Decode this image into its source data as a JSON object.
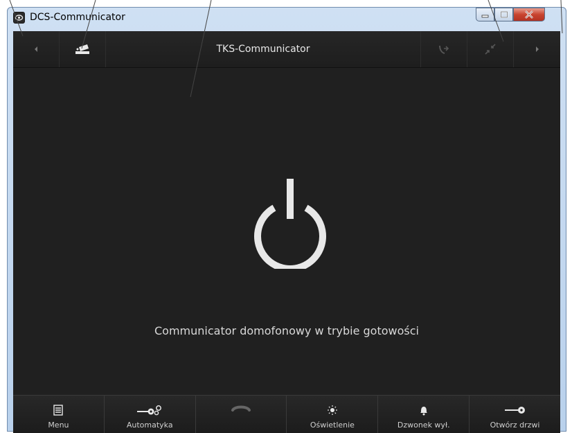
{
  "window": {
    "title": "DCS-Communicator",
    "controls": {
      "minimize": "minimize",
      "maximize": "maximize",
      "close": "close"
    }
  },
  "toolbar": {
    "title": "TKS-Communicator",
    "icons": [
      "back-arrow-icon",
      "camera-icon",
      "call-transfer-icon",
      "minimize-view-icon",
      "forward-arrow-icon"
    ]
  },
  "main": {
    "status_text": "Communicator domofonowy w trybie gotowości",
    "icon": "power-icon"
  },
  "bottom_bar": {
    "buttons": [
      {
        "label": "Menu",
        "icon": "menu-icon"
      },
      {
        "label": "Automatyka",
        "icon": "key-gear-icon"
      },
      {
        "label": "",
        "icon": "hang-up-icon"
      },
      {
        "label": "Oświetlenie",
        "icon": "light-icon"
      },
      {
        "label": "Dzwonek wył.",
        "icon": "bell-icon"
      },
      {
        "label": "Otwórz drzwi",
        "icon": "key-icon"
      }
    ]
  },
  "colors": {
    "background": "#202020",
    "text": "#d8d8d8",
    "close_button": "#c8442f"
  }
}
